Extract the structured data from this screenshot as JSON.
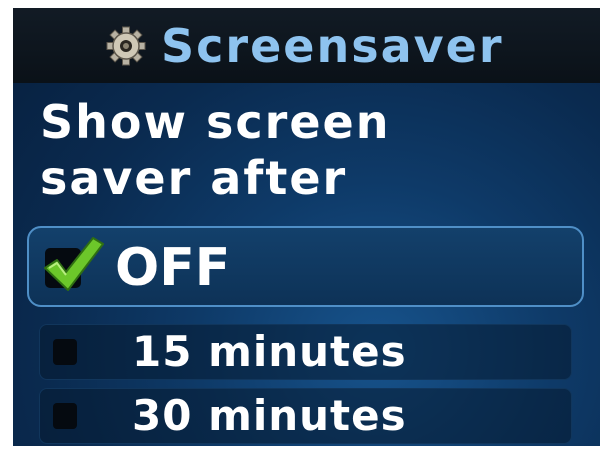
{
  "header": {
    "title": "Screensaver",
    "icon": "gear-icon"
  },
  "prompt": {
    "line1": "Show screen",
    "line2": "saver after"
  },
  "options": [
    {
      "label": "OFF",
      "checked": true
    },
    {
      "label": "15 minutes",
      "checked": false
    },
    {
      "label": "30 minutes",
      "checked": false
    }
  ],
  "colors": {
    "title_text": "#8ec3ef",
    "background": "#0e3a68",
    "selection_border": "#4f8fc7",
    "checkmark": "#6cc72a"
  }
}
